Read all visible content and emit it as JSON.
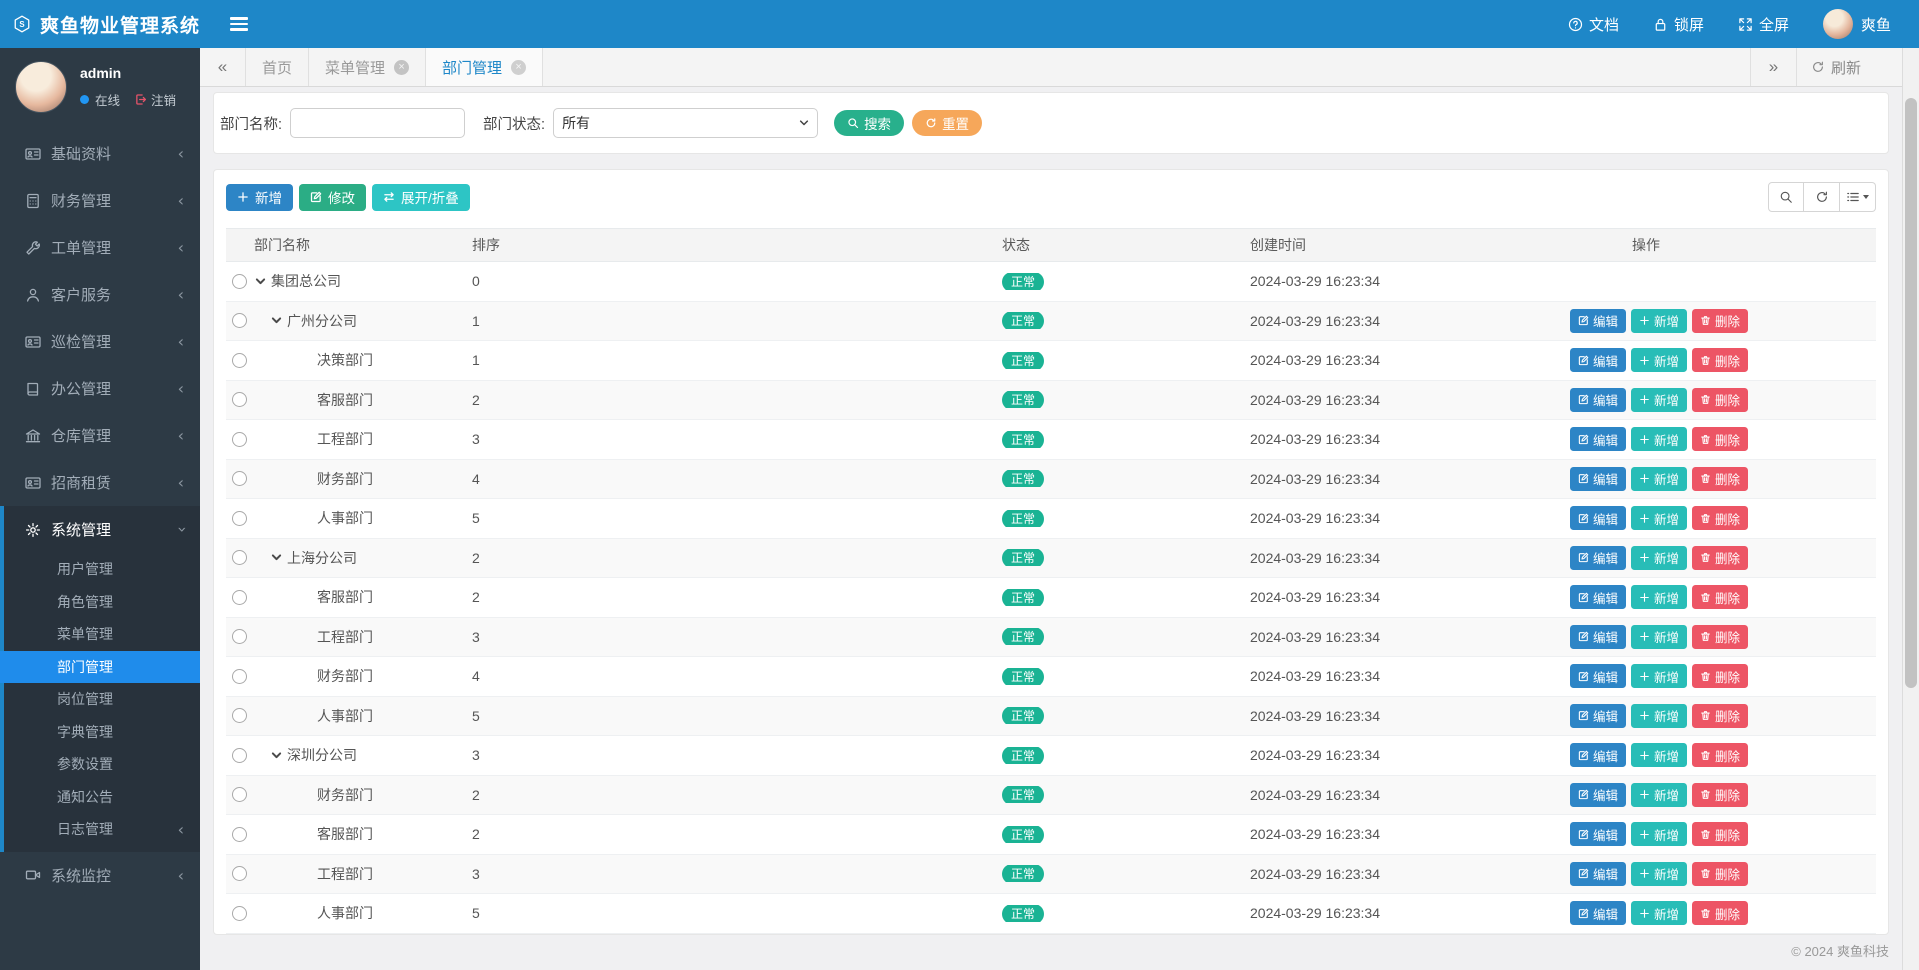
{
  "app": {
    "title": "爽鱼物业管理系统",
    "footer": "© 2024 爽鱼科技"
  },
  "header": {
    "docs": "文档",
    "lock": "锁屏",
    "fullscreen": "全屏",
    "username": "爽鱼"
  },
  "user": {
    "name": "admin",
    "status": "在线",
    "logout": "注销"
  },
  "sidebar": {
    "items": [
      {
        "label": "基础资料",
        "icon": "idcard-icon",
        "chevron": "left"
      },
      {
        "label": "财务管理",
        "icon": "calculator-icon",
        "chevron": "left"
      },
      {
        "label": "工单管理",
        "icon": "wrench-icon",
        "chevron": "left"
      },
      {
        "label": "客户服务",
        "icon": "user-icon",
        "chevron": "left"
      },
      {
        "label": "巡检管理",
        "icon": "idcard-icon",
        "chevron": "left"
      },
      {
        "label": "办公管理",
        "icon": "book-icon",
        "chevron": "left"
      },
      {
        "label": "仓库管理",
        "icon": "bank-icon",
        "chevron": "left"
      },
      {
        "label": "招商租赁",
        "icon": "idcard-icon",
        "chevron": "left"
      },
      {
        "label": "系统管理",
        "icon": "gear-icon",
        "chevron": "down",
        "expanded": true,
        "children": [
          {
            "label": "用户管理"
          },
          {
            "label": "角色管理"
          },
          {
            "label": "菜单管理"
          },
          {
            "label": "部门管理",
            "active": true
          },
          {
            "label": "岗位管理"
          },
          {
            "label": "字典管理"
          },
          {
            "label": "参数设置"
          },
          {
            "label": "通知公告"
          },
          {
            "label": "日志管理",
            "chevron": "left"
          }
        ]
      },
      {
        "label": "系统监控",
        "icon": "monitor-icon",
        "chevron": "left"
      }
    ]
  },
  "tabs": {
    "back": "«",
    "forward": "»",
    "refresh": "刷新",
    "items": [
      {
        "label": "首页",
        "closable": false,
        "active": false
      },
      {
        "label": "菜单管理",
        "closable": true,
        "active": false
      },
      {
        "label": "部门管理",
        "closable": true,
        "active": true
      }
    ]
  },
  "search": {
    "name_label": "部门名称:",
    "status_label": "部门状态:",
    "status_value": "所有",
    "search_btn": "搜索",
    "reset_btn": "重置"
  },
  "toolbar": {
    "add": "新增",
    "modify": "修改",
    "toggle": "展开/折叠"
  },
  "table": {
    "columns": [
      "部门名称",
      "排序",
      "状态",
      "创建时间",
      "操作"
    ],
    "row_actions": {
      "edit": "编辑",
      "add": "新增",
      "del": "删除"
    },
    "rows": [
      {
        "name": "集团总公司",
        "level": 0,
        "caret": true,
        "order": "0",
        "status": "正常",
        "created": "2024-03-29 16:23:34",
        "actions": false
      },
      {
        "name": "广州分公司",
        "level": 1,
        "caret": true,
        "order": "1",
        "status": "正常",
        "created": "2024-03-29 16:23:34",
        "actions": true
      },
      {
        "name": "决策部门",
        "level": 2,
        "caret": false,
        "order": "1",
        "status": "正常",
        "created": "2024-03-29 16:23:34",
        "actions": true
      },
      {
        "name": "客服部门",
        "level": 2,
        "caret": false,
        "order": "2",
        "status": "正常",
        "created": "2024-03-29 16:23:34",
        "actions": true
      },
      {
        "name": "工程部门",
        "level": 2,
        "caret": false,
        "order": "3",
        "status": "正常",
        "created": "2024-03-29 16:23:34",
        "actions": true
      },
      {
        "name": "财务部门",
        "level": 2,
        "caret": false,
        "order": "4",
        "status": "正常",
        "created": "2024-03-29 16:23:34",
        "actions": true
      },
      {
        "name": "人事部门",
        "level": 2,
        "caret": false,
        "order": "5",
        "status": "正常",
        "created": "2024-03-29 16:23:34",
        "actions": true
      },
      {
        "name": "上海分公司",
        "level": 1,
        "caret": true,
        "order": "2",
        "status": "正常",
        "created": "2024-03-29 16:23:34",
        "actions": true
      },
      {
        "name": "客服部门",
        "level": 2,
        "caret": false,
        "order": "2",
        "status": "正常",
        "created": "2024-03-29 16:23:34",
        "actions": true
      },
      {
        "name": "工程部门",
        "level": 2,
        "caret": false,
        "order": "3",
        "status": "正常",
        "created": "2024-03-29 16:23:34",
        "actions": true
      },
      {
        "name": "财务部门",
        "level": 2,
        "caret": false,
        "order": "4",
        "status": "正常",
        "created": "2024-03-29 16:23:34",
        "actions": true
      },
      {
        "name": "人事部门",
        "level": 2,
        "caret": false,
        "order": "5",
        "status": "正常",
        "created": "2024-03-29 16:23:34",
        "actions": true
      },
      {
        "name": "深圳分公司",
        "level": 1,
        "caret": true,
        "order": "3",
        "status": "正常",
        "created": "2024-03-29 16:23:34",
        "actions": true
      },
      {
        "name": "财务部门",
        "level": 2,
        "caret": false,
        "order": "2",
        "status": "正常",
        "created": "2024-03-29 16:23:34",
        "actions": true
      },
      {
        "name": "客服部门",
        "level": 2,
        "caret": false,
        "order": "2",
        "status": "正常",
        "created": "2024-03-29 16:23:34",
        "actions": true
      },
      {
        "name": "工程部门",
        "level": 2,
        "caret": false,
        "order": "3",
        "status": "正常",
        "created": "2024-03-29 16:23:34",
        "actions": true
      },
      {
        "name": "人事部门",
        "level": 2,
        "caret": false,
        "order": "5",
        "status": "正常",
        "created": "2024-03-29 16:23:34",
        "actions": true
      }
    ]
  },
  "colors": {
    "header_bg": "#1e87c8",
    "sidebar_bg": "#2d3a45",
    "active_item": "#1f8ceb",
    "primary": "#2d85c6",
    "success": "#2bad85",
    "info": "#2dc5c5",
    "warning": "#f6a75a",
    "danger": "#ed5565",
    "badge_normal": "#1ab394"
  }
}
